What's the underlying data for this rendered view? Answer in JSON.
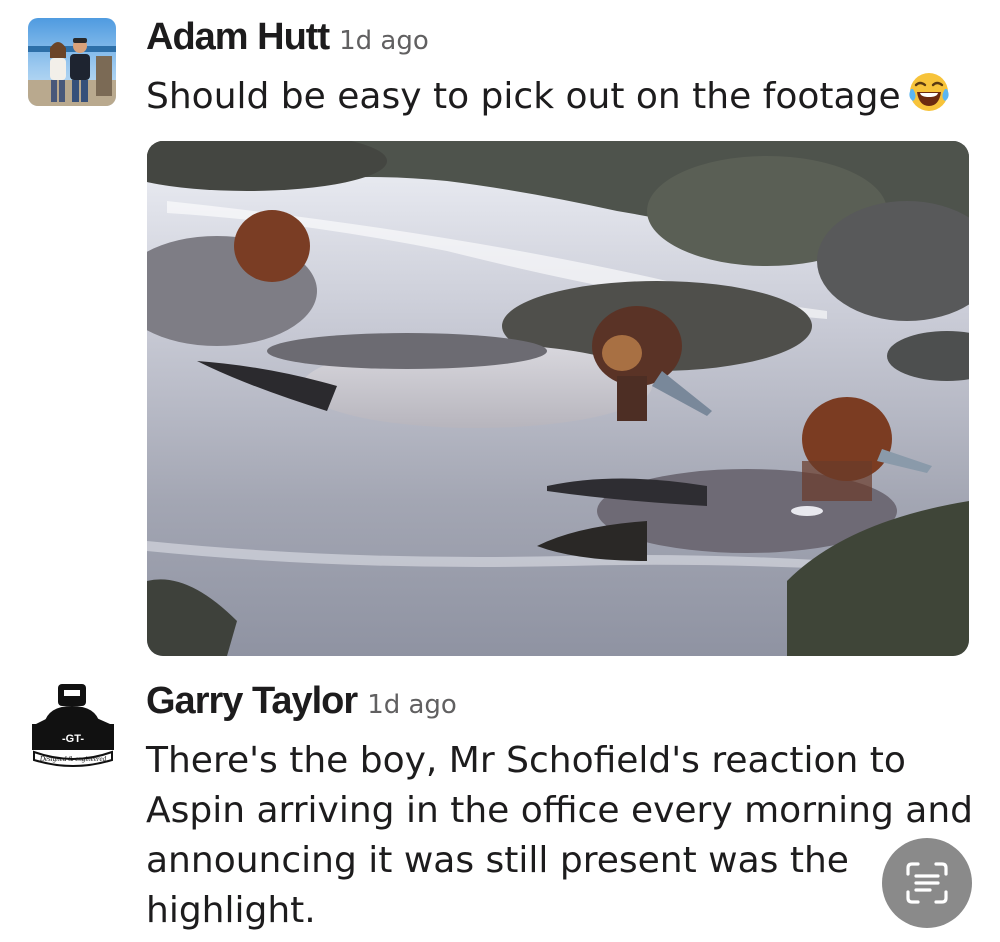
{
  "messages": [
    {
      "author": "Adam Hutt",
      "time": "1d ago",
      "text": "Should be easy to pick out on the footage",
      "emoji": "face-with-tears-of-joy-icon"
    },
    {
      "author": "Garry Taylor",
      "time": "1d ago",
      "text_lines": [
        "There's the boy, Mr Schofield's reaction to",
        "Aspin arriving in the office every morning and",
        "announcing it was still present was the",
        "highlight."
      ]
    }
  ],
  "logo": {
    "badge_text": "-GT-",
    "tagline": "Designed & engineered"
  },
  "colors": {
    "text": "#1d1c1d",
    "muted": "#616061",
    "fab": "#8a8a8a"
  },
  "icons": {
    "fab": "text-scan-icon"
  }
}
